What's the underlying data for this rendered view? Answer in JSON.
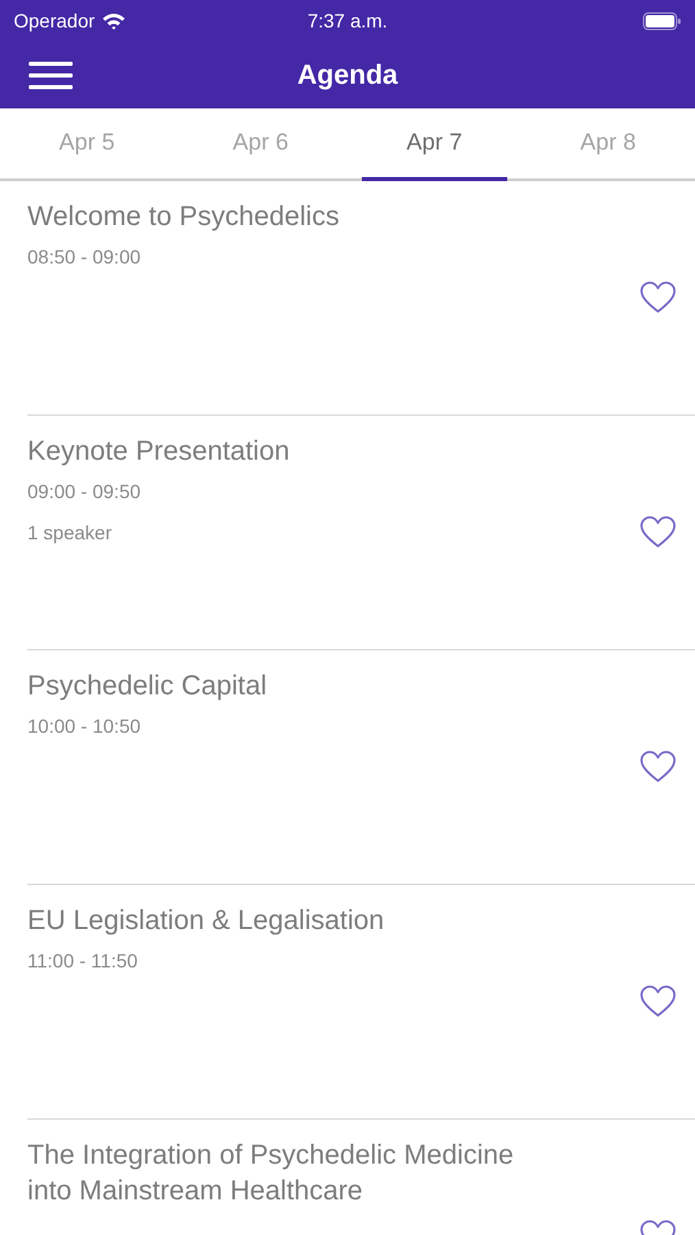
{
  "status_bar": {
    "carrier": "Operador",
    "time": "7:37 a.m."
  },
  "header": {
    "title": "Agenda"
  },
  "tabs": [
    {
      "label": "Apr 5",
      "selected": false
    },
    {
      "label": "Apr 6",
      "selected": false
    },
    {
      "label": "Apr 7",
      "selected": true
    },
    {
      "label": "Apr 8",
      "selected": false
    }
  ],
  "sessions": [
    {
      "title": "Welcome to Psychedelics",
      "time": "08:50 - 09:00",
      "favorite": false
    },
    {
      "title": "Keynote Presentation",
      "time": "09:00 - 09:50",
      "speakers": "1 speaker",
      "favorite": false
    },
    {
      "title": "Psychedelic Capital",
      "time": "10:00 - 10:50",
      "favorite": false
    },
    {
      "title": "EU Legislation & Legalisation",
      "time": "11:00 - 11:50",
      "favorite": false
    },
    {
      "title": "The Integration of Psychedelic Medicine into Mainstream Healthcare",
      "favorite": false
    }
  ]
}
